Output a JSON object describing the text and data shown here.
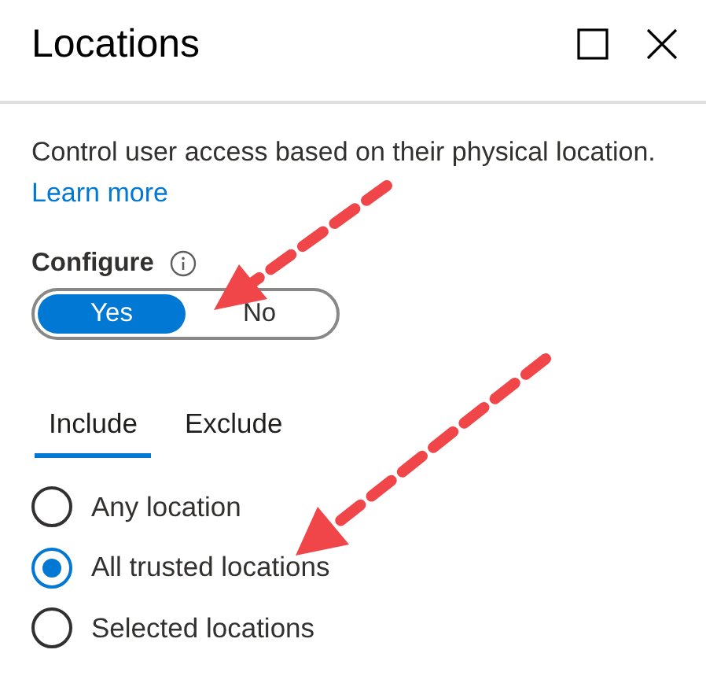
{
  "window": {
    "title": "Locations"
  },
  "description": {
    "text": "Control user access based on their physical location.",
    "link": "Learn more"
  },
  "configure": {
    "label": "Configure",
    "options": [
      {
        "label": "Yes",
        "selected": true
      },
      {
        "label": "No",
        "selected": false
      }
    ]
  },
  "tabs": [
    {
      "label": "Include",
      "selected": true
    },
    {
      "label": "Exclude",
      "selected": false
    }
  ],
  "location_options": [
    {
      "label": "Any location",
      "selected": false
    },
    {
      "label": "All trusted locations",
      "selected": true
    },
    {
      "label": "Selected locations",
      "selected": false
    }
  ]
}
